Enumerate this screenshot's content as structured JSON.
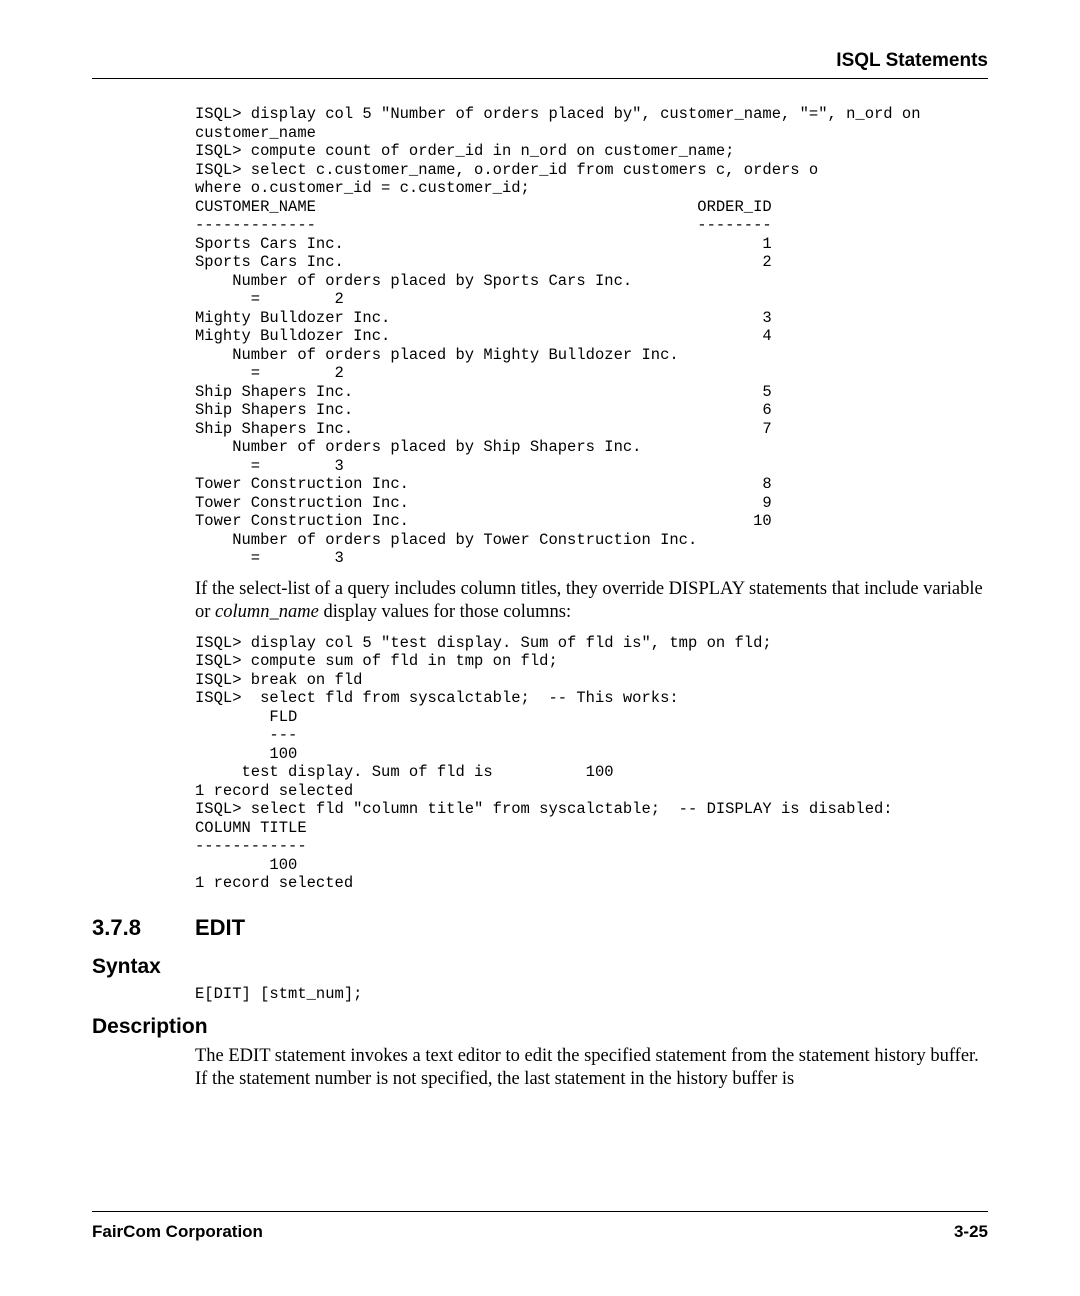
{
  "header": {
    "running_head": "ISQL Statements"
  },
  "code1": {
    "lines": [
      "ISQL> display col 5 \"Number of orders placed by\", customer_name, \"=\", n_ord on",
      "customer_name",
      "ISQL> compute count of order_id in n_ord on customer_name;",
      "ISQL> select c.customer_name, o.order_id from customers c, orders o",
      "where o.customer_id = c.customer_id;",
      "CUSTOMER_NAME                                         ORDER_ID",
      "-------------                                         --------",
      "Sports Cars Inc.                                             1",
      "Sports Cars Inc.                                             2",
      "    Number of orders placed by Sports Cars Inc.",
      "      =        2",
      "Mighty Bulldozer Inc.                                        3",
      "Mighty Bulldozer Inc.                                        4",
      "    Number of orders placed by Mighty Bulldozer Inc.",
      "      =        2",
      "Ship Shapers Inc.                                            5",
      "Ship Shapers Inc.                                            6",
      "Ship Shapers Inc.                                            7",
      "    Number of orders placed by Ship Shapers Inc.",
      "      =        3",
      "Tower Construction Inc.                                      8",
      "Tower Construction Inc.                                      9",
      "Tower Construction Inc.                                     10",
      "    Number of orders placed by Tower Construction Inc.",
      "      =        3"
    ]
  },
  "para1": {
    "pre": "If the select-list of a query includes column titles, they override DISPLAY statements that include variable or ",
    "italic": "column_name",
    "post": " display values for those columns:"
  },
  "code2": {
    "lines": [
      "ISQL> display col 5 \"test display. Sum of fld is\", tmp on fld;",
      "ISQL> compute sum of fld in tmp on fld;",
      "ISQL> break on fld",
      "ISQL>  select fld from syscalctable;  -- This works:",
      "        FLD",
      "        ---",
      "        100",
      "     test display. Sum of fld is          100",
      "1 record selected",
      "ISQL> select fld \"column title\" from syscalctable;  -- DISPLAY is disabled:",
      "COLUMN TITLE",
      "------------",
      "        100",
      "1 record selected"
    ]
  },
  "section": {
    "number": "3.7.8",
    "title": "EDIT"
  },
  "syntax": {
    "heading": "Syntax",
    "code": "E[DIT] [stmt_num];"
  },
  "description": {
    "heading": "Description",
    "text": "The EDIT statement invokes a text editor to edit the specified statement from the statement history buffer. If the statement number is not specified, the last statement in the history buffer is"
  },
  "footer": {
    "left": "FairCom Corporation",
    "right": "3-25"
  }
}
